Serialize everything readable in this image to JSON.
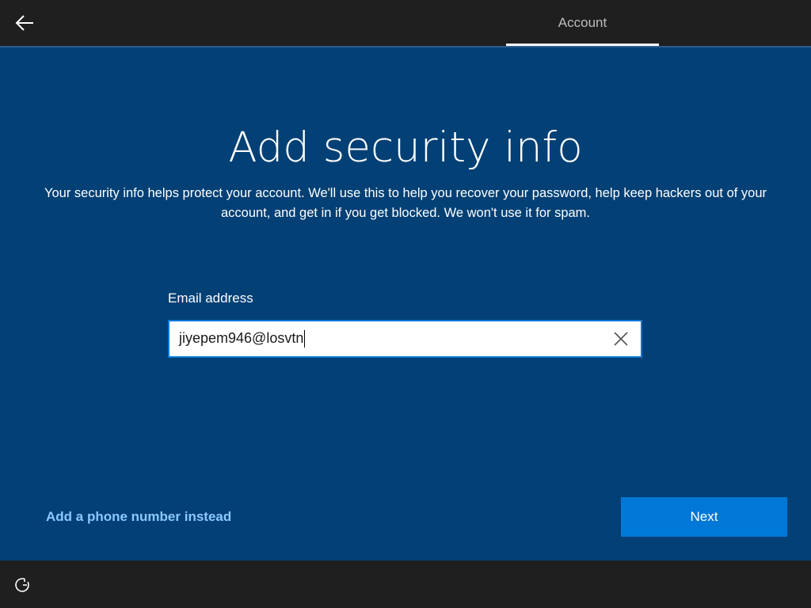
{
  "header": {
    "back_icon": "back-arrow-icon",
    "tab_label": "Account"
  },
  "main": {
    "title": "Add security info",
    "description": "Your security info helps protect your account. We'll use this to help you recover your password, help keep hackers out of your account, and get in if you get blocked. We won't use it for spam.",
    "email_label": "Email address",
    "email_value": "jiyepem946@losvtn",
    "clear_icon": "close-icon",
    "phone_link": "Add a phone number instead",
    "next_label": "Next"
  },
  "footer": {
    "accessibility_icon": "ease-of-access-icon"
  },
  "colors": {
    "background": "#034075",
    "bar": "#1f1f1f",
    "accent": "#0078d7",
    "link": "#8cc8ff"
  }
}
